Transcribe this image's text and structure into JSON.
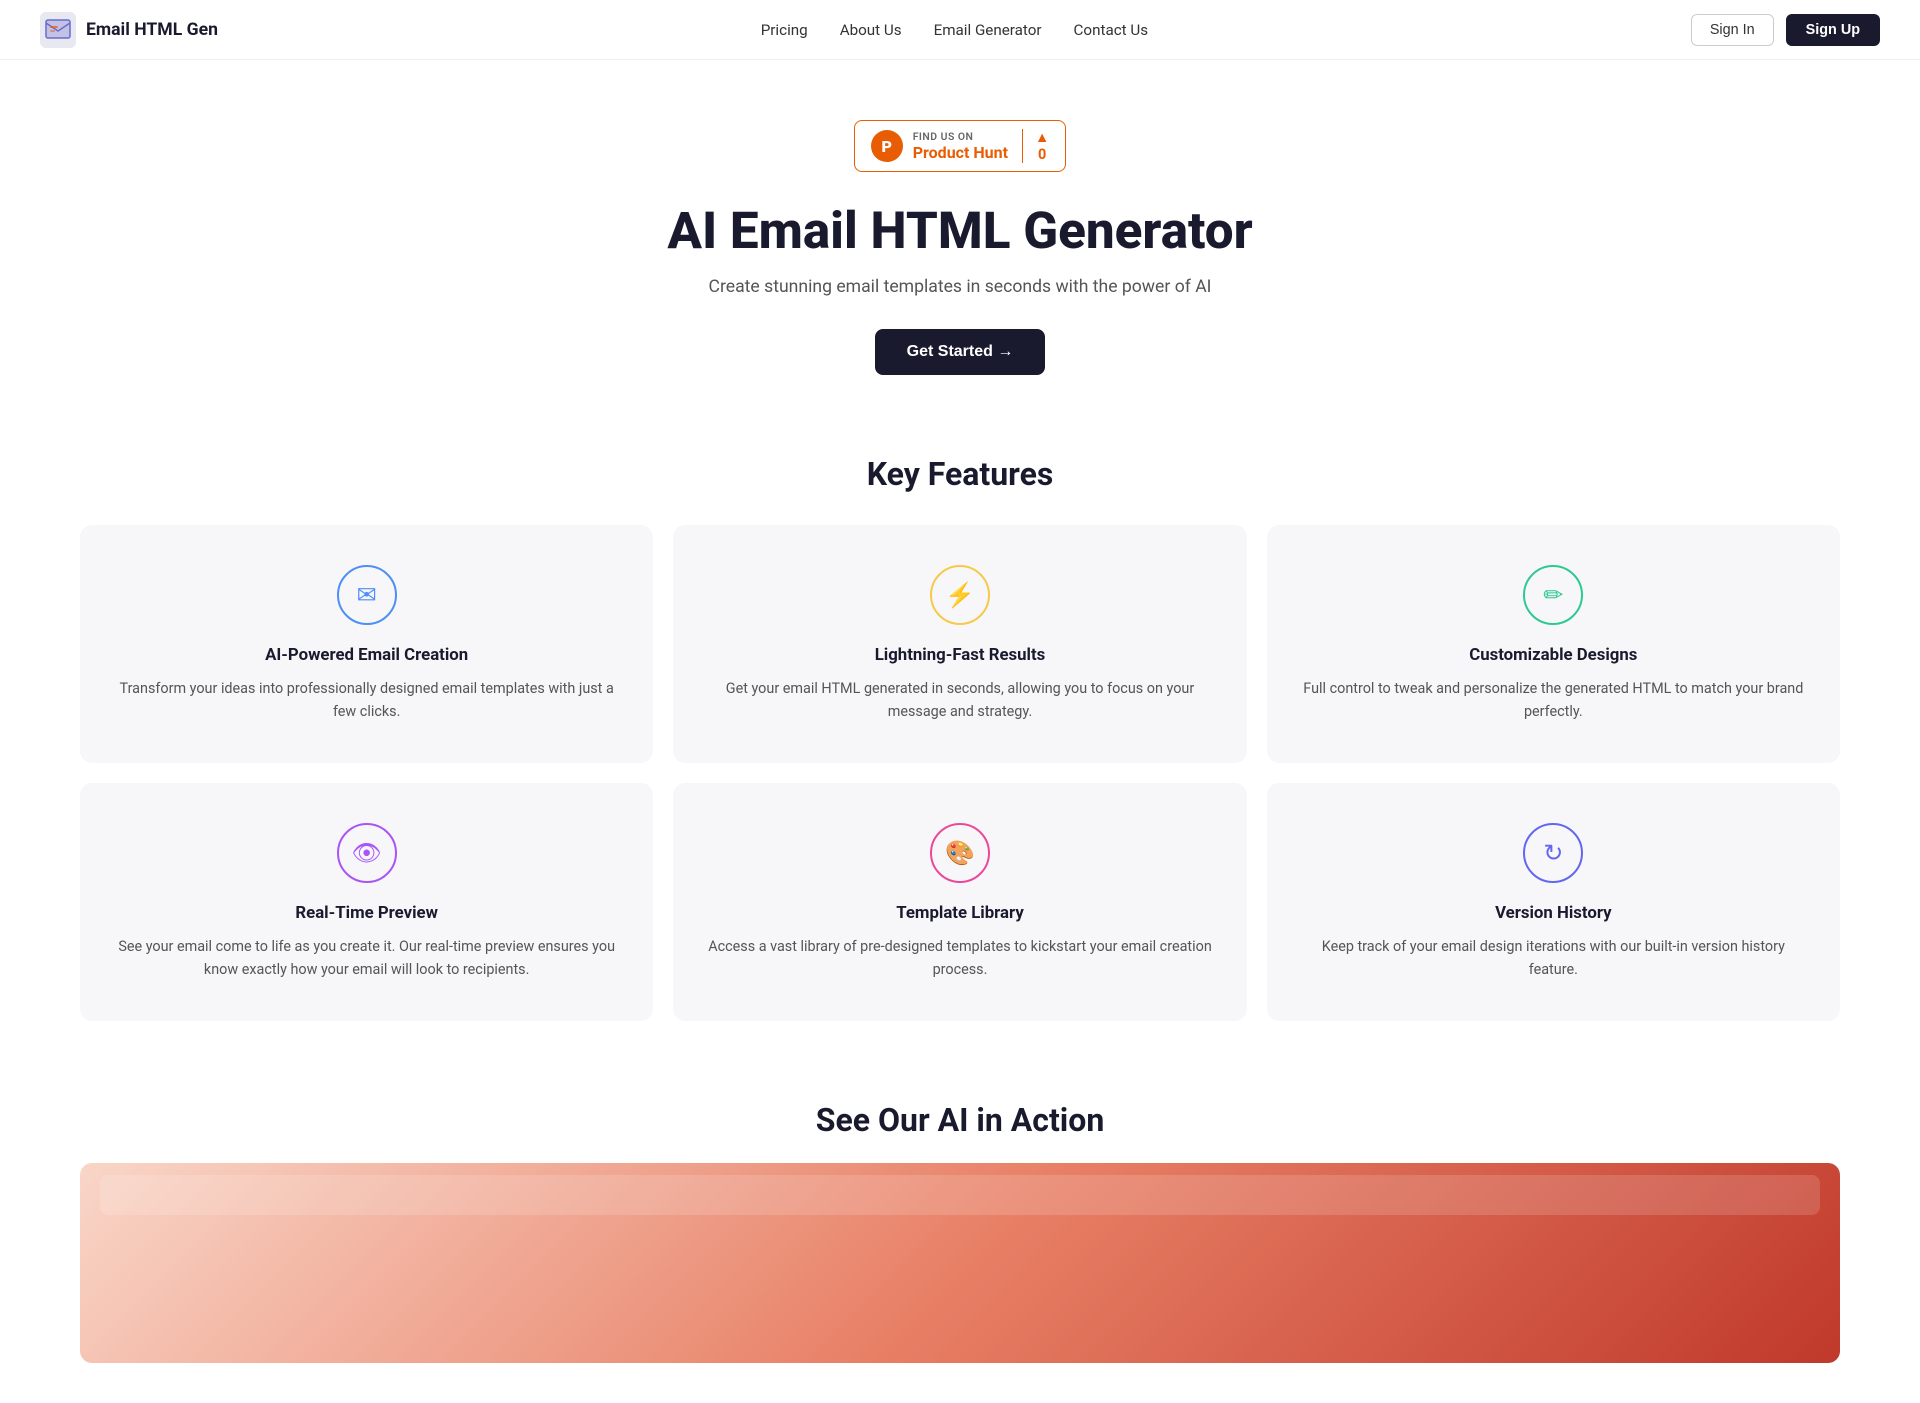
{
  "brand": {
    "name": "Email HTML Gen"
  },
  "nav": {
    "links": [
      {
        "id": "pricing",
        "label": "Pricing"
      },
      {
        "id": "about",
        "label": "About Us"
      },
      {
        "id": "generator",
        "label": "Email Generator"
      },
      {
        "id": "contact",
        "label": "Contact Us"
      }
    ],
    "signin_label": "Sign In",
    "signup_label": "Sign Up"
  },
  "product_hunt": {
    "find_text": "FIND US ON",
    "name": "Product Hunt",
    "icon_letter": "P",
    "score": "0",
    "arrow": "▲"
  },
  "hero": {
    "title": "AI Email HTML Generator",
    "subtitle": "Create stunning email templates in seconds with the power of AI",
    "cta_label": "Get Started →"
  },
  "features_section": {
    "heading": "Key Features",
    "features": [
      {
        "id": "ai-creation",
        "icon": "✉",
        "icon_class": "icon-blue",
        "title": "AI-Powered Email Creation",
        "description": "Transform your ideas into professionally designed email templates with just a few clicks."
      },
      {
        "id": "fast-results",
        "icon": "⚡",
        "icon_class": "icon-yellow",
        "title": "Lightning-Fast Results",
        "description": "Get your email HTML generated in seconds, allowing you to focus on your message and strategy."
      },
      {
        "id": "customizable",
        "icon": "✏",
        "icon_class": "icon-green",
        "title": "Customizable Designs",
        "description": "Full control to tweak and personalize the generated HTML to match your brand perfectly."
      },
      {
        "id": "preview",
        "icon": "👁",
        "icon_class": "icon-purple",
        "title": "Real-Time Preview",
        "description": "See your email come to life as you create it. Our real-time preview ensures you know exactly how your email will look to recipients."
      },
      {
        "id": "template-library",
        "icon": "🎨",
        "icon_class": "icon-pink",
        "title": "Template Library",
        "description": "Access a vast library of pre-designed templates to kickstart your email creation process."
      },
      {
        "id": "version-history",
        "icon": "↻",
        "icon_class": "icon-indigo",
        "title": "Version History",
        "description": "Keep track of your email design iterations with our built-in version history feature."
      }
    ]
  },
  "ai_action_section": {
    "heading": "See Our AI in Action"
  }
}
